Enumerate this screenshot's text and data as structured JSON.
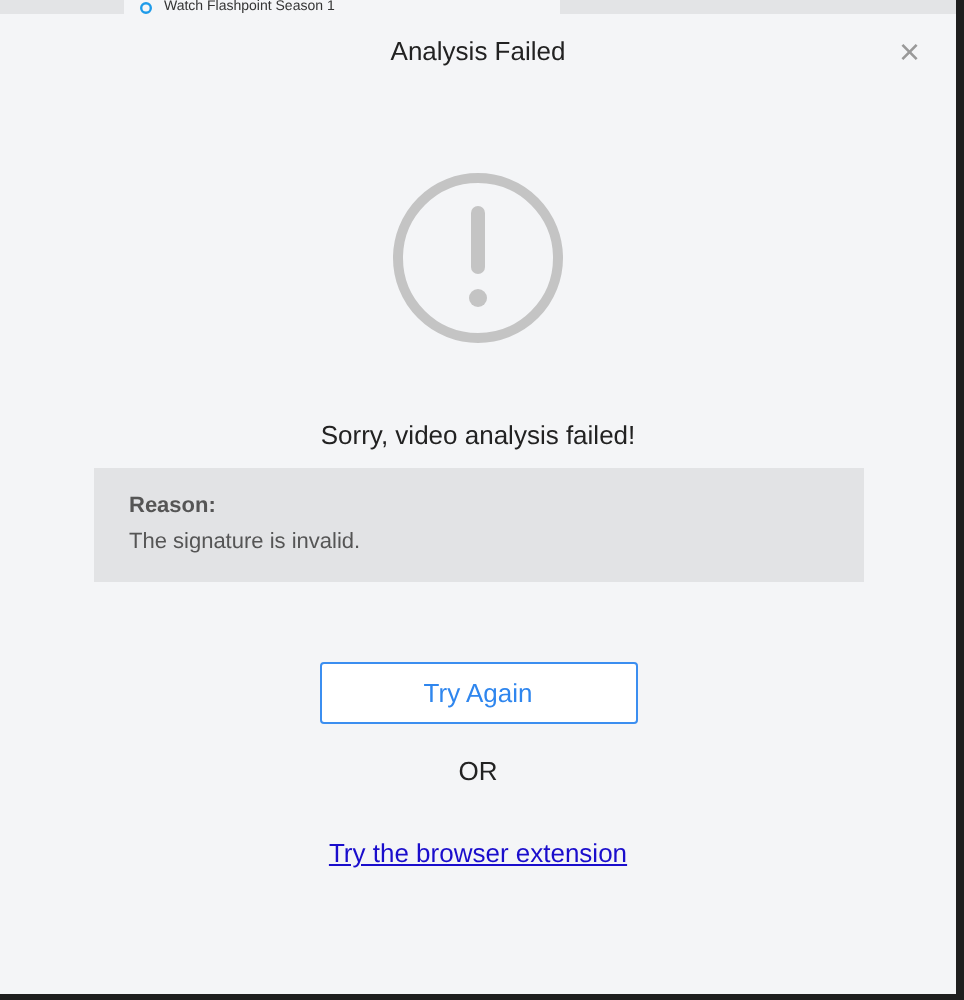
{
  "background_tab": {
    "label": "Watch Flashpoint Season 1"
  },
  "dialog": {
    "title": "Analysis Failed",
    "close": "×",
    "message": "Sorry, video analysis failed!",
    "reason": {
      "label": "Reason:",
      "text": "The signature is invalid."
    },
    "primary_button": "Try Again",
    "separator": "OR",
    "link": "Try the browser extension"
  }
}
